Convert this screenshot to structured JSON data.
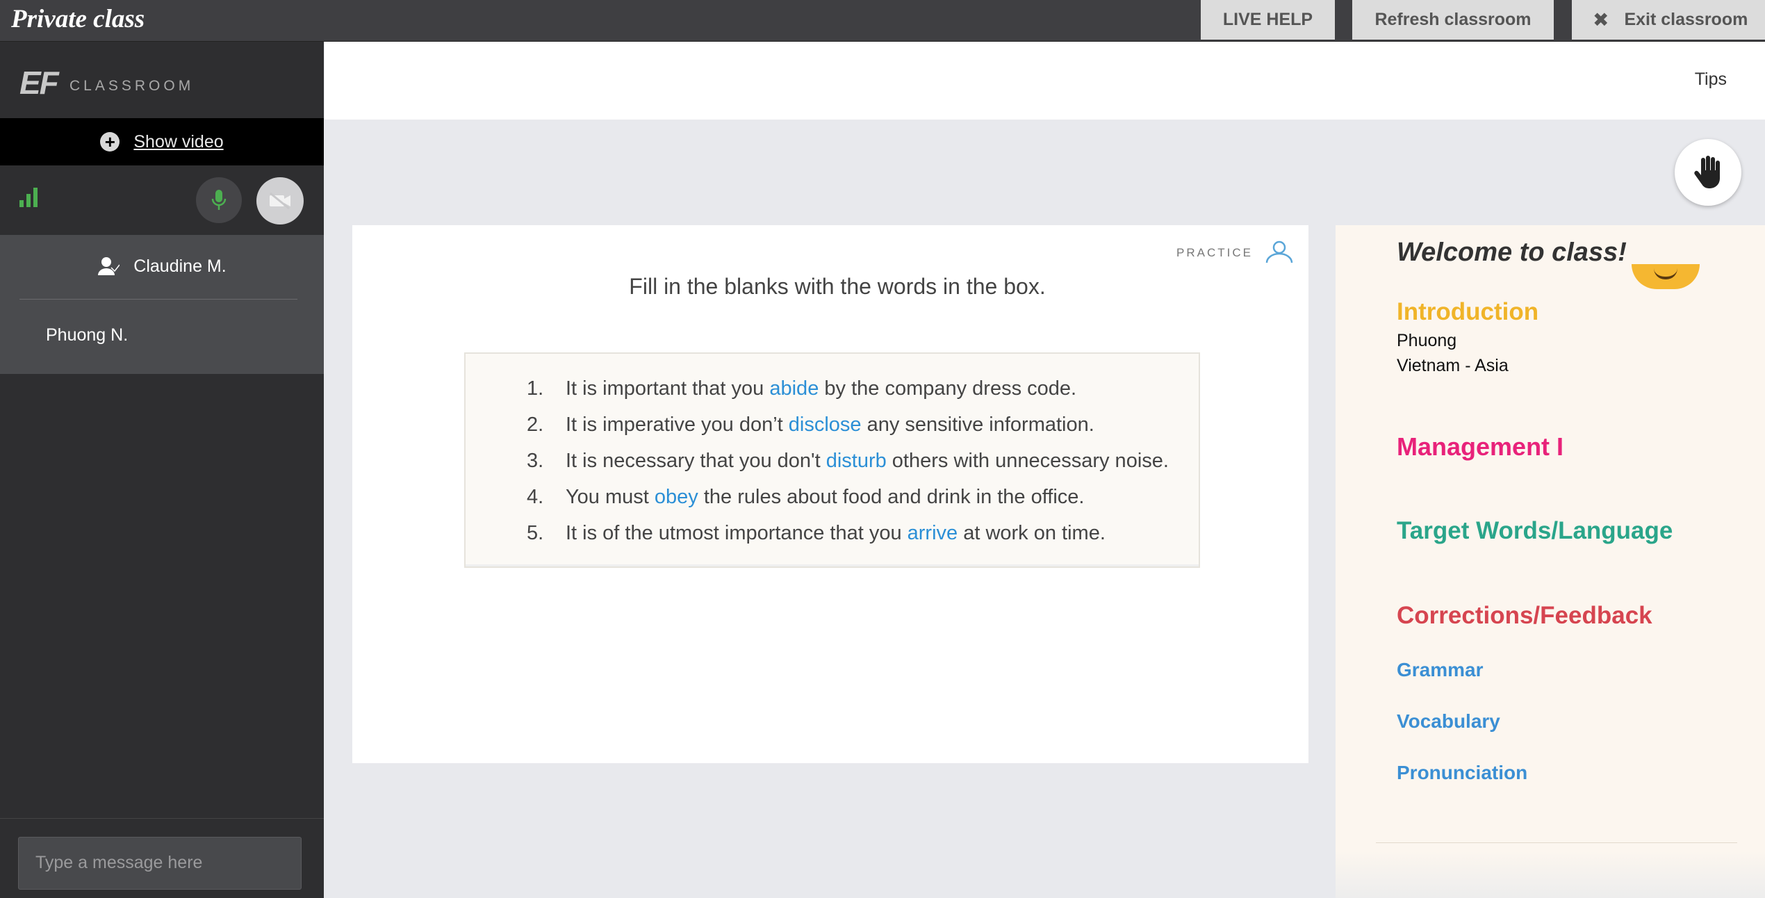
{
  "topbar": {
    "title": "Private class",
    "live_help": "LIVE HELP",
    "refresh": "Refresh classroom",
    "exit": "Exit classroom"
  },
  "sidebar": {
    "logo_mark": "EF",
    "logo_text": "CLASSROOM",
    "show_video": "Show video",
    "signal_color": "#4caf50",
    "participants": [
      "Claudine M.",
      "Phuong N."
    ],
    "chat_placeholder": "Type a message here"
  },
  "main": {
    "tips": "Tips",
    "practice_label": "PRACTICE",
    "instruction": "Fill in the blanks with the words in the box.",
    "items": [
      {
        "num": "1.",
        "pre": "It is important that you ",
        "answer": "abide",
        "post": " by the company dress code."
      },
      {
        "num": "2.",
        "pre": "It is imperative you don’t ",
        "answer": "disclose",
        "post": " any sensitive information."
      },
      {
        "num": "3.",
        "pre": "It is necessary that you don't ",
        "answer": "disturb",
        "post": " others with unnecessary noise."
      },
      {
        "num": "4.",
        "pre": "You must ",
        "answer": "obey",
        "post": " the rules about food and drink in the office."
      },
      {
        "num": "5.",
        "pre": "It is of the utmost importance that you ",
        "answer": "arrive",
        "post": " at work on time."
      }
    ],
    "answer_color": "#2b8fd6"
  },
  "notes": {
    "welcome": "Welcome to class!",
    "intro_heading": "Introduction",
    "intro_name": "Phuong",
    "intro_location": "Vietnam - Asia",
    "management": "Management I",
    "target": "Target Words/Language",
    "corrections": "Corrections/Feedback",
    "grammar": "Grammar",
    "vocabulary": "Vocabulary",
    "pronunciation": "Pronunciation",
    "colors": {
      "intro": "#f0b429",
      "management": "#e8227a",
      "target": "#2aa58a",
      "corrections": "#d64550",
      "sub": "#3b8fd4"
    }
  }
}
